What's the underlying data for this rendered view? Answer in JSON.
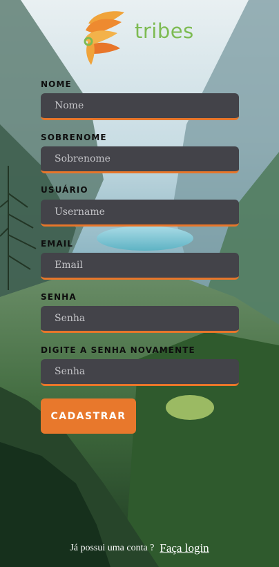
{
  "brand": {
    "name": "tribes",
    "logo_icon": "feather-headdress-icon"
  },
  "form": {
    "fields": [
      {
        "label": "NOME",
        "placeholder": "Nome"
      },
      {
        "label": "SOBRENOME",
        "placeholder": "Sobrenome"
      },
      {
        "label": "USUÁRIO",
        "placeholder": "Username"
      },
      {
        "label": "EMAIL",
        "placeholder": "Email"
      },
      {
        "label": "SENHA",
        "placeholder": "Senha"
      },
      {
        "label": "DIGITE A SENHA NOVAMENTE",
        "placeholder": "Senha"
      }
    ],
    "submit_label": "CADASTRAR"
  },
  "footer": {
    "question": "Já possui uma conta ?",
    "login_link": "Faça login"
  },
  "colors": {
    "accent": "#e8782c",
    "brand_green": "#7dbb52",
    "field_bg": "#434349"
  }
}
